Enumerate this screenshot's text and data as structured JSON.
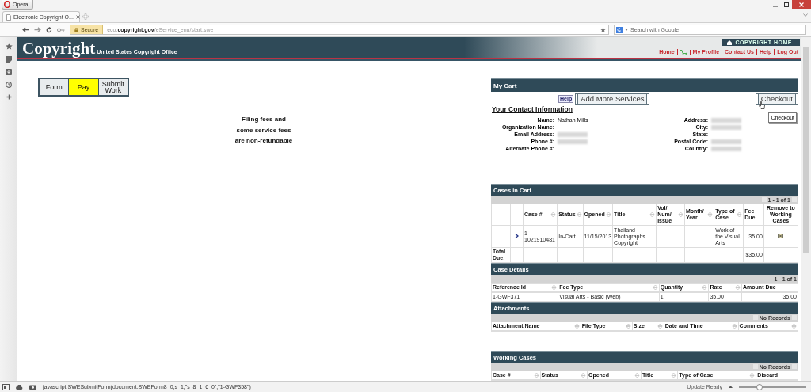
{
  "browser": {
    "menu_button": "Opera",
    "tabs": [
      {
        "title": "Electronic Copyright O...",
        "selected": true
      }
    ],
    "address": {
      "secure_label": "Secure",
      "url_prefix": "eco.",
      "url_domain": "copyright.gov",
      "url_path": "/eService_enu/start.swe"
    },
    "search": {
      "placeholder": "Search with Google"
    }
  },
  "header": {
    "logo": "Copyright",
    "subtitle": "United States Copyright Office",
    "home_button": "COPYRIGHT HOME",
    "nav": [
      {
        "kind": "link",
        "label": "Home"
      },
      {
        "kind": "cart"
      },
      {
        "kind": "link",
        "label": "My Profile"
      },
      {
        "kind": "link",
        "label": "Contact Us"
      },
      {
        "kind": "link",
        "label": "Help"
      },
      {
        "kind": "link",
        "label": "Log Out"
      }
    ]
  },
  "steps": [
    {
      "label": "Form",
      "selected": false
    },
    {
      "label": "Pay",
      "selected": true
    },
    {
      "label": "Submit Work",
      "selected": false
    }
  ],
  "notice": [
    "Filing fees and",
    "some service fees",
    "are non-refundable"
  ],
  "cart": {
    "title": "My Cart",
    "help_label": "Help",
    "add_button": "Add More Services",
    "checkout_button": "Checkout",
    "tooltip": "Checkout",
    "contact_title": "Your Contact Information",
    "contact_left": [
      {
        "label": "Name:",
        "value": "Nathan Mills",
        "redacted": false
      },
      {
        "label": "Organization Name:",
        "redacted": false
      },
      {
        "label": "Email Address:",
        "redacted": true
      },
      {
        "label": "Phone #:",
        "redacted": true
      },
      {
        "label": "Alternate Phone #:",
        "redacted": false
      }
    ],
    "contact_right": [
      {
        "label": "Address:",
        "redacted": true
      },
      {
        "label": "City:",
        "redacted": true
      },
      {
        "label": "State:",
        "redacted": false
      },
      {
        "label": "Postal Code:",
        "redacted": true
      },
      {
        "label": "Country:",
        "redacted": true
      }
    ]
  },
  "sections": [
    {
      "title": "Cases in Cart",
      "pager": "1 - 1 of 1",
      "pager_arrows": true,
      "columns": [
        {
          "kind": "empty"
        },
        {
          "kind": "empty"
        },
        {
          "label": "Case #",
          "sortable": true
        },
        {
          "label": "Status",
          "sortable": true
        },
        {
          "label": "Opened",
          "sortable": true
        },
        {
          "label": "Title",
          "sortable": true
        },
        {
          "label": "Vol/ Num/ Issue",
          "sortable": true
        },
        {
          "label": "Month/ Year",
          "sortable": true
        },
        {
          "label": "Type of Case",
          "sortable": true
        },
        {
          "label": "Fee Due",
          "sortable": false
        },
        {
          "label": "Remove to Working Cases",
          "sortable": false
        }
      ],
      "rows": [
        [
          {
            "kind": "empty"
          },
          {
            "kind": "expand"
          },
          {
            "text": "1-1021910481"
          },
          {
            "text": "In-Cart"
          },
          {
            "text": "11/15/2013"
          },
          {
            "text": "Thailand Photographs Copyright"
          },
          {
            "kind": "empty"
          },
          {
            "kind": "empty"
          },
          {
            "text": "Work of the Visual Arts"
          },
          {
            "text": "35.00"
          },
          {
            "kind": "remove"
          }
        ],
        [
          {
            "text": "Total Due:",
            "bold": true
          },
          {
            "kind": "empty"
          },
          {
            "kind": "empty"
          },
          {
            "kind": "empty"
          },
          {
            "kind": "empty"
          },
          {
            "kind": "empty"
          },
          {
            "kind": "empty"
          },
          {
            "kind": "empty"
          },
          {
            "kind": "empty"
          },
          {
            "text": "$35.00"
          },
          {
            "kind": "empty"
          }
        ]
      ]
    },
    {
      "title": "Case Details",
      "pager": "1 - 1 of 1",
      "pager_arrows": false,
      "columns": [
        {
          "label": "Reference Id",
          "sortable": true
        },
        {
          "label": "Fee Type",
          "sortable": true
        },
        {
          "label": "Quantity",
          "sortable": true
        },
        {
          "label": "Rate",
          "sortable": true
        },
        {
          "label": "Amount Due",
          "sortable": false
        }
      ],
      "rows": [
        [
          {
            "text": "1-GWF371"
          },
          {
            "text": "Visual Arts - Basic (Web)"
          },
          {
            "text": "1"
          },
          {
            "text": "35.00"
          },
          {
            "text": "35.00"
          }
        ]
      ]
    },
    {
      "title": "Attachments",
      "pager": "No Records",
      "pager_arrows": true,
      "columns": [
        {
          "label": "Attachment Name",
          "sortable": true
        },
        {
          "label": "File Type",
          "sortable": true
        },
        {
          "label": "Size",
          "sortable": true
        },
        {
          "label": "Date and Time",
          "sortable": true
        },
        {
          "label": "Comments",
          "sortable": true
        }
      ]
    },
    {
      "title": "Working Cases",
      "pager": "No Records",
      "pager_arrows": true,
      "columns": [
        {
          "label": "Case #",
          "sortable": true
        },
        {
          "label": "Status",
          "sortable": true
        },
        {
          "label": "Opened",
          "sortable": true
        },
        {
          "label": "Title",
          "sortable": true
        },
        {
          "label": "Type of Case",
          "sortable": true
        },
        {
          "label": "Discard",
          "sortable": false
        }
      ]
    }
  ],
  "status_bar": {
    "url": "javascript:SWESubmitForm(document.SWEForm8_0,s_1,\"s_8_1_6_0\",\"1-GWF358\")",
    "update": "Update Ready",
    "zoom": {
      "level": 0.3
    }
  }
}
